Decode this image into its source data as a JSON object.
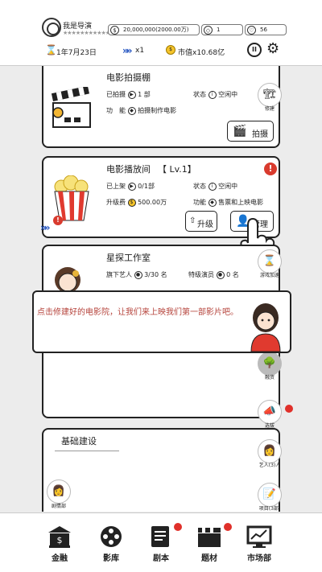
{
  "header": {
    "player_name": "我是导演",
    "stars": "★★★★★★★★★★★★",
    "money": "20,000,000(2000.00万)",
    "gems": "1",
    "hearts": "56",
    "date": "1年7月23日",
    "speed": "x1",
    "market_cap": "市值x10.68亿",
    "coin_symbol": "$"
  },
  "cards": {
    "studio": {
      "title": "电影拍摄棚",
      "shot_label": "已拍摄",
      "shot_value": "1 部",
      "status_label": "状态",
      "status_value": "空闲中",
      "func_label": "功　能",
      "func_value": "拍摄制作电影",
      "shoot_button": "拍摄",
      "side_label": "修建"
    },
    "cinema": {
      "title": "电影播放间",
      "level": "【 Lv.1】",
      "shown_label": "已上架",
      "shown_value": "0/1部",
      "status_label": "状态",
      "status_value": "空闲中",
      "upgrade_label": "升级费",
      "upgrade_value": "500.00万",
      "func_label": "功能",
      "func_value": "售票和上映电影",
      "upgrade_button": "升级",
      "manage_button": "管理",
      "alert": "!"
    },
    "talent": {
      "title": "星探工作室",
      "artists_label": "旗下艺人",
      "artists_value": "3/30 名",
      "special_label": "特级演员",
      "special_value": "0 名"
    },
    "infra": {
      "title": "基础建设"
    }
  },
  "dialog": {
    "message": "点击修建好的电影院，让我们来上映我们第一部影片吧。"
  },
  "side": {
    "btn1_label": "修建",
    "btn2_label": "游戏加速",
    "btn3_label": "融资",
    "btn4_label": "选拔",
    "btn5_label": "艺人(3)人",
    "btn6_label": "项目(3部)",
    "left_label": "剧情部"
  },
  "nav": {
    "items": [
      {
        "label": "金融",
        "icon": "bank-icon"
      },
      {
        "label": "影库",
        "icon": "film-reel-icon"
      },
      {
        "label": "剧本",
        "icon": "script-icon"
      },
      {
        "label": "题材",
        "icon": "clapperboard-icon"
      },
      {
        "label": "市场部",
        "icon": "chart-monitor-icon"
      }
    ]
  },
  "colors": {
    "accent_red": "#d93b2e",
    "dialog_text": "#b5423a",
    "speed_blue": "#1d4fbf",
    "coin_gold": "#f6c52b"
  }
}
